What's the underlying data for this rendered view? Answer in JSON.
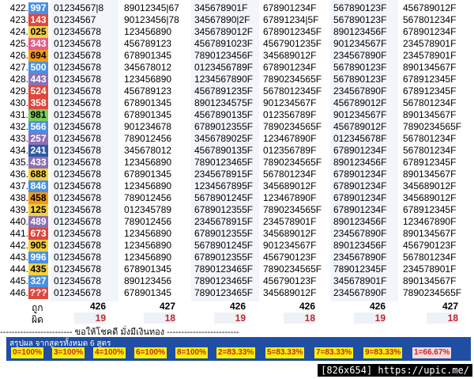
{
  "rows": [
    {
      "n": "422.",
      "v": "997",
      "c": "#4a90e2",
      "tc": "#fff",
      "cols": [
        "01234567|8",
        "89012345|67",
        "345678901F",
        "678901234F",
        "567890123F",
        "456789012F"
      ]
    },
    {
      "n": "423.",
      "v": "143",
      "c": "#e0473c",
      "tc": "#fff",
      "cols": [
        "01234567",
        "90123456|78",
        "34567890|2F",
        "67891234|5F",
        "567890123F",
        "567801234F"
      ]
    },
    {
      "n": "424.",
      "v": "025",
      "c": "#f4d03f",
      "tc": "#000",
      "cols": [
        "012345678",
        "123456890",
        "3456789012F",
        "6789012345F",
        "890123456F",
        "678901234F"
      ]
    },
    {
      "n": "425.",
      "v": "343",
      "c": "#e55d87",
      "tc": "#fff",
      "cols": [
        "012345678",
        "456789123",
        "4567891023F",
        "4567901235F",
        "901234567F",
        "234578901F"
      ]
    },
    {
      "n": "426.",
      "v": "694",
      "c": "#f39c12",
      "tc": "#000",
      "cols": [
        "012345678",
        "678901345",
        "7890123456F",
        "345689012F",
        "234567890F",
        "234578901F"
      ]
    },
    {
      "n": "427.",
      "v": "500",
      "c": "#4a90e2",
      "tc": "#fff",
      "cols": [
        "012345678",
        "345678012",
        "0123456789F",
        "678901234F",
        "567890123F",
        "890134567F"
      ]
    },
    {
      "n": "428.",
      "v": "443",
      "c": "#8e6fb5",
      "tc": "#fff",
      "cols": [
        "012345678",
        "123456890",
        "1234567890F",
        "7890234565F",
        "567890123F",
        "678912345F"
      ]
    },
    {
      "n": "429.",
      "v": "524",
      "c": "#e0473c",
      "tc": "#fff",
      "cols": [
        "012345678",
        "456789123",
        "4567891235F",
        "5678012345F",
        "234567890F",
        "678912345F"
      ]
    },
    {
      "n": "430.",
      "v": "358",
      "c": "#e0473c",
      "tc": "#fff",
      "cols": [
        "012345678",
        "678901345",
        "8901234575F",
        "901234567F",
        "456789012F",
        "567801234F"
      ]
    },
    {
      "n": "431.",
      "v": "981",
      "c": "#7ecb5f",
      "tc": "#000",
      "cols": [
        "012345678",
        "678901345",
        "4567890135F",
        "012356789F",
        "901234567F",
        "890134567F"
      ]
    },
    {
      "n": "432.",
      "v": "566",
      "c": "#4a90e2",
      "tc": "#fff",
      "cols": [
        "012345678",
        "901234678",
        "6789012355F",
        "7890234565F",
        "456789012F",
        "7890234565F"
      ]
    },
    {
      "n": "433.",
      "v": "257",
      "c": "#8e6fb5",
      "tc": "#fff",
      "cols": [
        "012345678",
        "789012456",
        "3456789025F",
        "123467890F",
        "012345678F",
        "567801234F"
      ]
    },
    {
      "n": "434.",
      "v": "241",
      "c": "#2c5aa0",
      "tc": "#fff",
      "cols": [
        "012345678",
        "345678012",
        "4567890135F",
        "012356789F",
        "678901234F",
        "567801234F"
      ]
    },
    {
      "n": "435.",
      "v": "433",
      "c": "#8e6fb5",
      "tc": "#fff",
      "cols": [
        "012345678",
        "123456890",
        "7890123465F",
        "7890234565F",
        "890123456F",
        "678912345F"
      ]
    },
    {
      "n": "436.",
      "v": "688",
      "c": "#f4d03f",
      "tc": "#000",
      "cols": [
        "012345678",
        "678901345",
        "2345678915F",
        "567801234F",
        "678901234F",
        "890134567F"
      ]
    },
    {
      "n": "437.",
      "v": "846",
      "c": "#4a90e2",
      "tc": "#fff",
      "cols": [
        "012345678",
        "123456890",
        "1234567895F",
        "345689012F",
        "678901234F",
        "345689012F"
      ]
    },
    {
      "n": "438.",
      "v": "458",
      "c": "#f39c12",
      "tc": "#000",
      "cols": [
        "012345678",
        "789012456",
        "5678901245F",
        "123467890F",
        "678901234F",
        "345689012F"
      ]
    },
    {
      "n": "439.",
      "v": "125",
      "c": "#f4d03f",
      "tc": "#000",
      "cols": [
        "012345678",
        "012345789",
        "6789012355F",
        "7890234565F",
        "678901234F",
        "678912345F"
      ]
    },
    {
      "n": "440.",
      "v": "489",
      "c": "#8e6fb5",
      "tc": "#fff",
      "cols": [
        "012345678",
        "789012456",
        "2345678915F",
        "234578901F",
        "890123456F",
        "123467890F"
      ]
    },
    {
      "n": "441.",
      "v": "673",
      "c": "#e0473c",
      "tc": "#fff",
      "cols": [
        "012345678",
        "123456890",
        "6789012355F",
        "345689012F",
        "234567890F",
        "890134567F"
      ]
    },
    {
      "n": "442.",
      "v": "905",
      "c": "#f4d03f",
      "tc": "#000",
      "cols": [
        "012345678",
        "123456890",
        "5678901245F",
        "901234567F",
        "890123456F",
        "456790123F"
      ]
    },
    {
      "n": "443.",
      "v": "996",
      "c": "#4a90e2",
      "tc": "#fff",
      "cols": [
        "012345678",
        "123456890",
        "6789012355F",
        "456790123F",
        "234567890F",
        "567801234F"
      ]
    },
    {
      "n": "444.",
      "v": "435",
      "c": "#f4d03f",
      "tc": "#000",
      "cols": [
        "012345678",
        "678901345",
        "7890123465F",
        "7890234565F",
        "789012345F",
        "234578901F"
      ]
    },
    {
      "n": "445.",
      "v": "327",
      "c": "#4a90e2",
      "tc": "#fff",
      "cols": [
        "012345678",
        "890123456",
        "7890123465F",
        "456790123F",
        "345678901F",
        "890134567F"
      ]
    },
    {
      "n": "446.",
      "v": "???",
      "c": "#e0473c",
      "tc": "#fff",
      "cols": [
        "012345678",
        "678901345",
        "7890123465F",
        "345689012F",
        "234567890F",
        "7890234565F"
      ]
    }
  ],
  "totals": {
    "right_label": "ถูก",
    "wrong_label": "ผิด",
    "right": [
      "426",
      "427",
      "426",
      "426",
      "426",
      "427"
    ],
    "wrong": [
      "19",
      "18",
      "19",
      "18",
      "19",
      "18"
    ]
  },
  "wish_text": "------------------------- ขอให้โชคดี มั่งมีเงินทอง -------------------------",
  "summary": {
    "title": "สรุปผล จากสูตรทั้งหมด 6 สูตร",
    "badges": [
      {
        "label": "0=100%",
        "ok": true
      },
      {
        "label": "3=100%",
        "ok": true
      },
      {
        "label": "4=100%",
        "ok": true
      },
      {
        "label": "6=100%",
        "ok": true
      },
      {
        "label": "8=100%",
        "ok": true
      },
      {
        "label": "2=83.33%",
        "ok": true
      },
      {
        "label": "5=83.33%",
        "ok": true
      },
      {
        "label": "7=83.33%",
        "ok": true
      },
      {
        "label": "9=83.33%",
        "ok": true
      },
      {
        "label": "1=66.67%",
        "ok": false
      }
    ]
  },
  "signature": "[826x654] https://upic.me/"
}
